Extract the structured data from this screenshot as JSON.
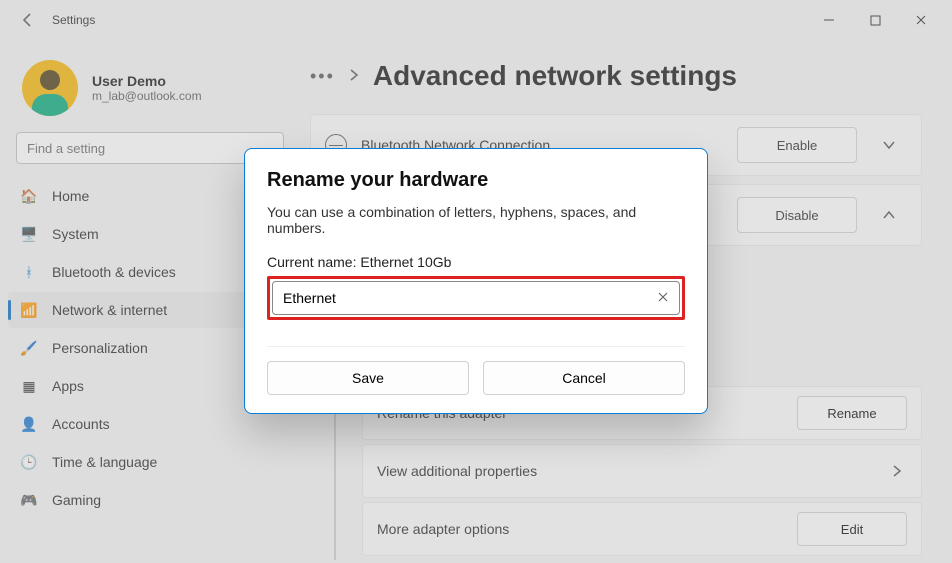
{
  "window": {
    "title": "Settings"
  },
  "user": {
    "name": "User Demo",
    "email": "m_lab@outlook.com"
  },
  "search": {
    "placeholder": "Find a setting"
  },
  "nav": {
    "home": "Home",
    "system": "System",
    "bluetooth": "Bluetooth & devices",
    "network": "Network & internet",
    "personalization": "Personalization",
    "apps": "Apps",
    "accounts": "Accounts",
    "time": "Time & language",
    "gaming": "Gaming"
  },
  "header": {
    "title": "Advanced network settings"
  },
  "adapters": {
    "bluetooth": {
      "name": "Bluetooth Network Connection",
      "action": "Enable"
    },
    "ethernet": {
      "action": "Disable"
    }
  },
  "subactions": {
    "rename": {
      "label": "Rename this adapter",
      "button": "Rename"
    },
    "viewprops": {
      "label": "View additional properties"
    },
    "moreopts": {
      "label": "More adapter options",
      "button": "Edit"
    }
  },
  "dialog": {
    "title": "Rename your hardware",
    "desc": "You can use a combination of letters, hyphens, spaces, and numbers.",
    "current_label": "Current name: Ethernet 10Gb",
    "input_value": "Ethernet",
    "save": "Save",
    "cancel": "Cancel"
  }
}
